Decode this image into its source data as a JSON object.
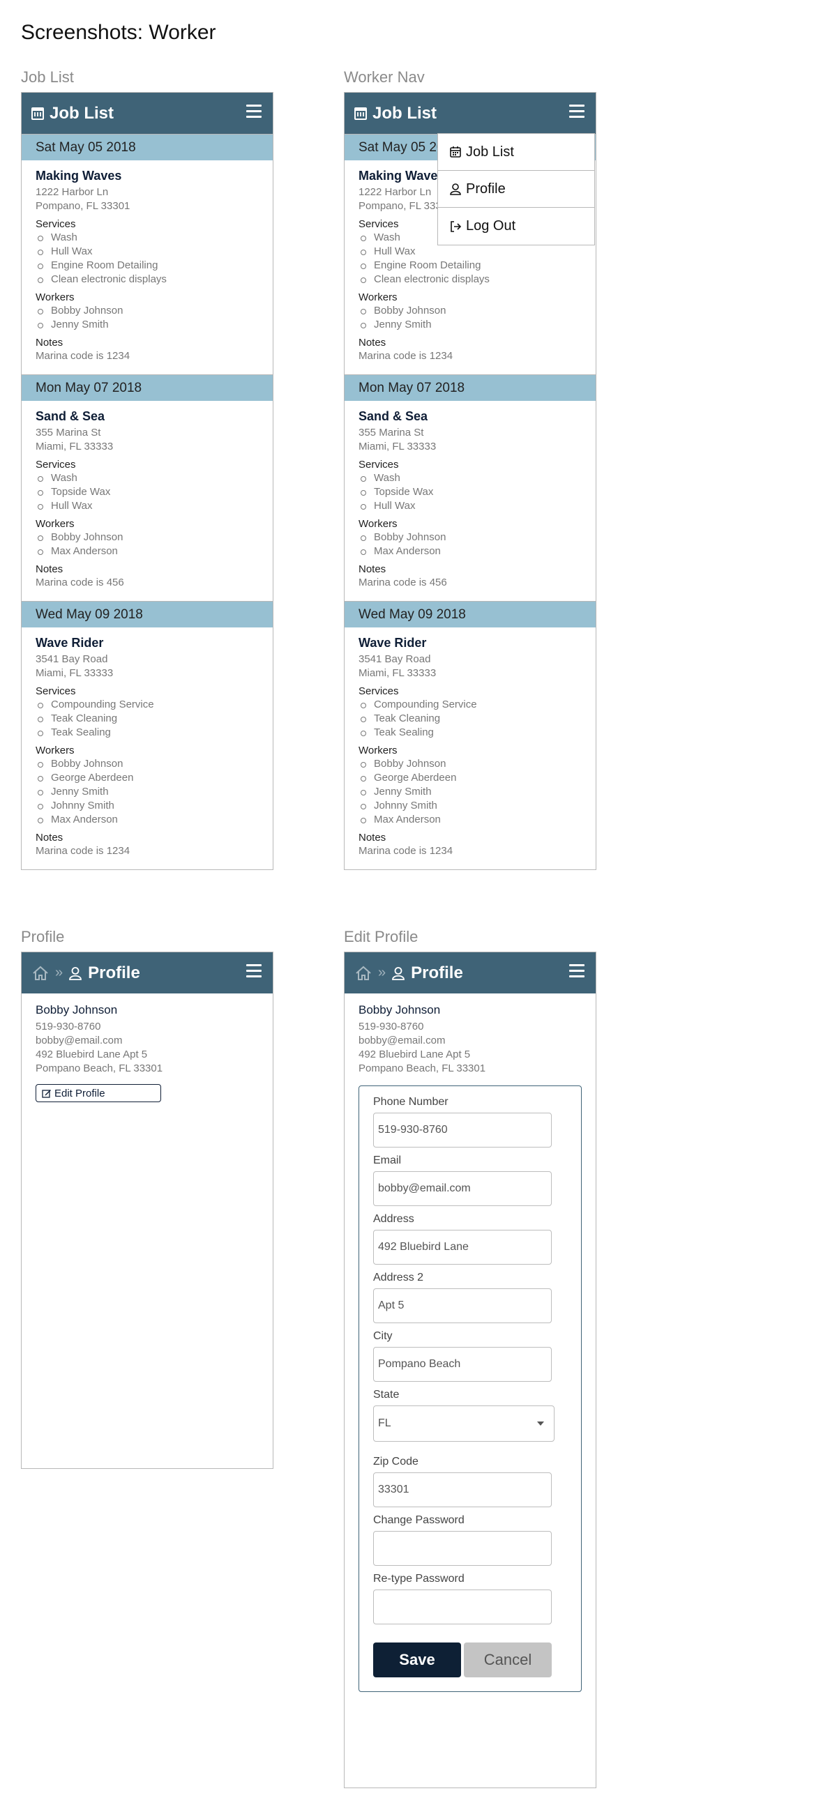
{
  "page_title": "Screenshots: Worker",
  "sections": {
    "job_list": "Job List",
    "worker_nav": "Worker Nav",
    "profile": "Profile",
    "edit_profile": "Edit Profile"
  },
  "topbar": {
    "job_list_title": "Job List",
    "profile_title": "Profile"
  },
  "labels": {
    "services": "Services",
    "workers": "Workers",
    "notes": "Notes"
  },
  "jobs": [
    {
      "date": "Sat May 05 2018",
      "name": "Making Waves",
      "address1": "1222 Harbor Ln",
      "address2": "Pompano, FL 33301",
      "services": [
        "Wash",
        "Hull Wax",
        "Engine Room Detailing",
        "Clean electronic displays"
      ],
      "workers": [
        "Bobby Johnson",
        "Jenny Smith"
      ],
      "notes": "Marina code is 1234"
    },
    {
      "date": "Mon May 07 2018",
      "name": "Sand & Sea",
      "address1": "355 Marina St",
      "address2": "Miami, FL 33333",
      "services": [
        "Wash",
        "Topside Wax",
        "Hull Wax"
      ],
      "workers": [
        "Bobby Johnson",
        "Max Anderson"
      ],
      "notes": "Marina code is 456"
    },
    {
      "date": "Wed May 09 2018",
      "name": "Wave Rider",
      "address1": "3541 Bay Road",
      "address2": "Miami, FL 33333",
      "services": [
        "Compounding Service",
        "Teak Cleaning",
        "Teak Sealing"
      ],
      "workers": [
        "Bobby Johnson",
        "George Aberdeen",
        "Jenny Smith",
        "Johnny Smith",
        "Max Anderson"
      ],
      "notes": "Marina code is 1234"
    }
  ],
  "nav_menu": {
    "job_list": "Job List",
    "profile": "Profile",
    "log_out": "Log Out"
  },
  "profile": {
    "name": "Bobby Johnson",
    "phone": "519-930-8760",
    "email": "bobby@email.com",
    "address": "492 Bluebird Lane Apt 5",
    "city_line": "Pompano Beach, FL 33301",
    "edit_button": "Edit Profile"
  },
  "form": {
    "phone_label": "Phone Number",
    "phone_value": "519-930-8760",
    "email_label": "Email",
    "email_value": "bobby@email.com",
    "address_label": "Address",
    "address_value": "492 Bluebird Lane",
    "address2_label": "Address 2",
    "address2_value": "Apt 5",
    "city_label": "City",
    "city_value": "Pompano Beach",
    "state_label": "State",
    "state_value": "FL",
    "zip_label": "Zip Code",
    "zip_value": "33301",
    "password_label": "Change Password",
    "password_value": "",
    "retype_label": "Re-type Password",
    "retype_value": "",
    "save": "Save",
    "cancel": "Cancel"
  },
  "colors": {
    "topbar": "#3f6377",
    "date_bar": "#97c0d2",
    "save_button": "#0e2035",
    "cancel_button": "#c4c4c4"
  },
  "icons": {
    "calendar": "calendar-icon",
    "menu": "hamburger-menu-icon",
    "user": "user-icon",
    "logout": "logout-icon",
    "home": "home-icon",
    "breadcrumb": "double-chevron-icon",
    "edit": "edit-icon"
  }
}
